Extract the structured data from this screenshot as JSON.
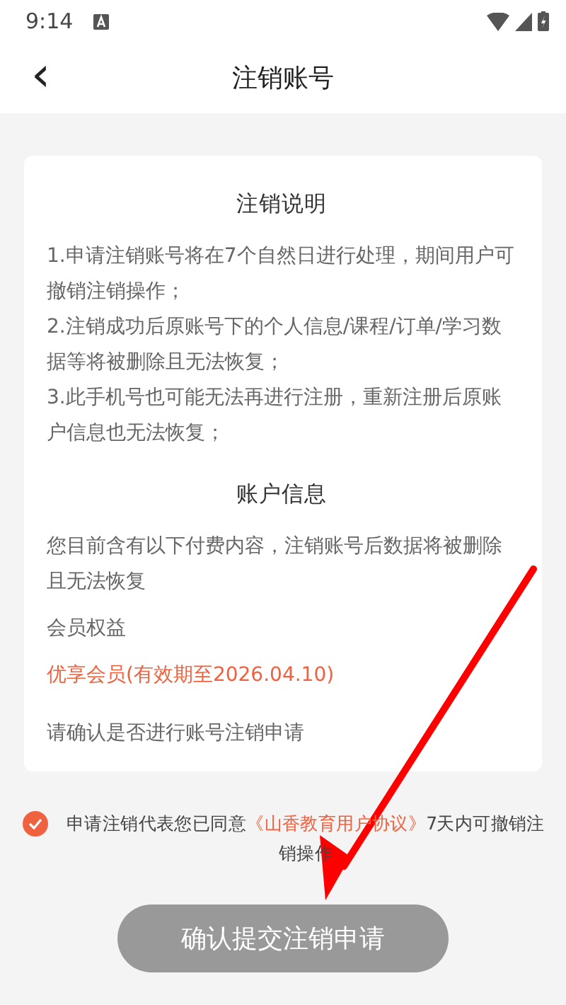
{
  "status_bar": {
    "time": "9:14"
  },
  "nav": {
    "back": "‹",
    "title": "注销账号"
  },
  "card": {
    "sections": [
      {
        "title": "注销说明",
        "paragraphs": [
          {
            "kind": "plain",
            "text": "1.申请注销账号将在7个自然日进行处理，期间用户可撤销注销操作；"
          },
          {
            "kind": "plain",
            "text": "2.注销成功后原账号下的个人信息/课程/订单/学习数据等将被删除且无法恢复；"
          },
          {
            "kind": "plain",
            "text": "3.此手机号也可能无法再进行注册，重新注册后原账户信息也无法恢复；"
          }
        ]
      },
      {
        "title": "账户信息",
        "paragraphs": [
          {
            "kind": "spaced",
            "text": "您目前含有以下付费内容，注销账号后数据将被删除且无法恢复"
          },
          {
            "kind": "spaced",
            "text": "会员权益"
          },
          {
            "kind": "highlight",
            "text": "优享会员(有效期至2026.04.10)"
          },
          {
            "kind": "gap",
            "text": "请确认是否进行账号注销申请"
          }
        ]
      }
    ]
  },
  "agreement": {
    "checked": true,
    "before": "申请注销代表您已同意",
    "link": "《山香教育用户协议》",
    "after": "7天内可撤销注销操作"
  },
  "submit": {
    "label": "确认提交注销申请",
    "disabled": true
  }
}
